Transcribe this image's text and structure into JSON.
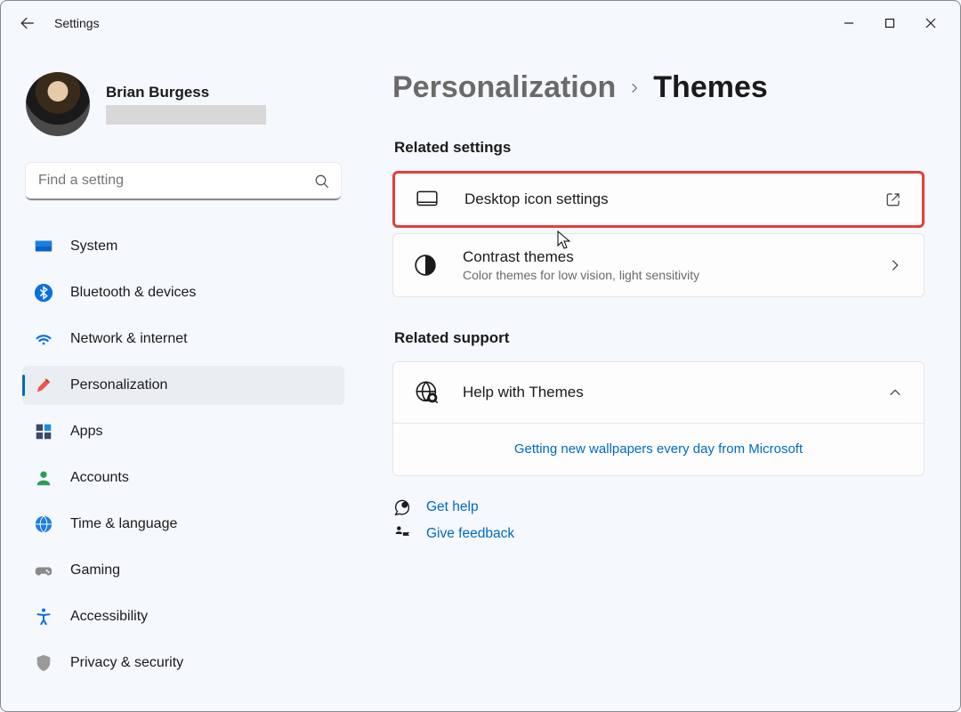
{
  "window": {
    "app_title": "Settings"
  },
  "user": {
    "name": "Brian Burgess"
  },
  "search": {
    "placeholder": "Find a setting"
  },
  "nav": {
    "items": [
      {
        "label": "System"
      },
      {
        "label": "Bluetooth & devices"
      },
      {
        "label": "Network & internet"
      },
      {
        "label": "Personalization"
      },
      {
        "label": "Apps"
      },
      {
        "label": "Accounts"
      },
      {
        "label": "Time & language"
      },
      {
        "label": "Gaming"
      },
      {
        "label": "Accessibility"
      },
      {
        "label": "Privacy & security"
      }
    ]
  },
  "breadcrumb": {
    "parent": "Personalization",
    "current": "Themes"
  },
  "sections": {
    "related_settings": "Related settings",
    "related_support": "Related support"
  },
  "cards": {
    "desktop_icon": {
      "title": "Desktop icon settings"
    },
    "contrast": {
      "title": "Contrast themes",
      "sub": "Color themes for low vision, light sensitivity"
    }
  },
  "support": {
    "title": "Help with Themes",
    "link": "Getting new wallpapers every day from Microsoft"
  },
  "footer": {
    "get_help": "Get help",
    "give_feedback": "Give feedback"
  }
}
